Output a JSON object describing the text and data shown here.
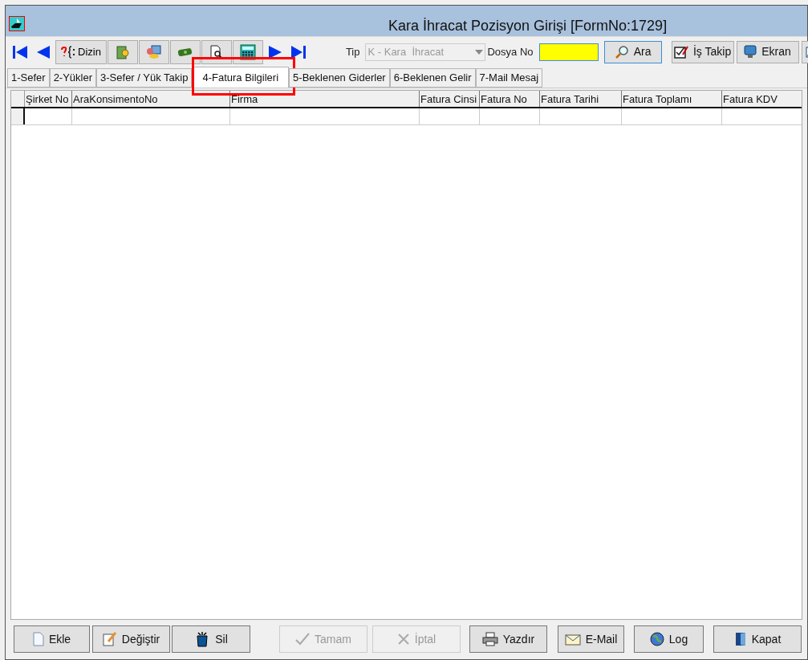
{
  "window": {
    "title": "Kara İhracat Pozisyon Girişi [FormNo:1729]"
  },
  "toolbar": {
    "buttons": [
      {
        "kind": "first"
      },
      {
        "kind": "prev"
      },
      {
        "kind": "dizin",
        "label": "Dizin"
      },
      {
        "kind": "package"
      },
      {
        "kind": "palette"
      },
      {
        "kind": "money"
      },
      {
        "kind": "preview"
      },
      {
        "kind": "calculator"
      },
      {
        "kind": "next"
      },
      {
        "kind": "last"
      }
    ],
    "tip": {
      "label": "Tip",
      "value": "K - Kara  İhracat",
      "disabled": true
    },
    "dosya": {
      "label": "Dosya No"
    },
    "right_buttons": [
      {
        "kind": "search",
        "label": "Ara"
      },
      {
        "kind": "task",
        "label": "İş Takip"
      },
      {
        "kind": "screen",
        "label": "Ekran"
      },
      {
        "kind": "cut"
      }
    ]
  },
  "tabs": [
    {
      "label": "1-Sefer",
      "selected": false,
      "highlighted": false
    },
    {
      "label": "2-Yükler",
      "selected": false,
      "highlighted": false
    },
    {
      "label": "3-Sefer / Yük Takip",
      "selected": false,
      "highlighted": false
    },
    {
      "label": "4-Fatura Bilgileri",
      "selected": true,
      "highlighted": true
    },
    {
      "label": "5-Beklenen Giderler",
      "selected": false,
      "highlighted": false
    },
    {
      "label": "6-Beklenen Gelir",
      "selected": false,
      "highlighted": false
    },
    {
      "label": "7-Mail Mesaj",
      "selected": false,
      "highlighted": false
    }
  ],
  "table": {
    "columns": [
      "Şirket No",
      "AraKonsimentoNo",
      "Firma",
      "Fatura Cinsi",
      "Fatura No",
      "Fatura Tarihi",
      "Fatura Toplamı",
      "Fatura KDV"
    ]
  },
  "bottom_buttons": [
    {
      "kind": "add",
      "label": "Ekle",
      "disabled": false
    },
    {
      "kind": "edit",
      "label": "Değiştir",
      "disabled": false
    },
    {
      "kind": "delete",
      "label": "Sil",
      "disabled": false
    },
    {
      "kind": "ok",
      "label": "Tamam",
      "disabled": true
    },
    {
      "kind": "cancel",
      "label": "İptal",
      "disabled": true
    },
    {
      "kind": "print",
      "label": "Yazdır",
      "disabled": false
    },
    {
      "kind": "mail",
      "label": "E-Mail",
      "disabled": false
    },
    {
      "kind": "log",
      "label": "Log",
      "disabled": false
    },
    {
      "kind": "close",
      "label": "Kapat",
      "disabled": false
    }
  ]
}
